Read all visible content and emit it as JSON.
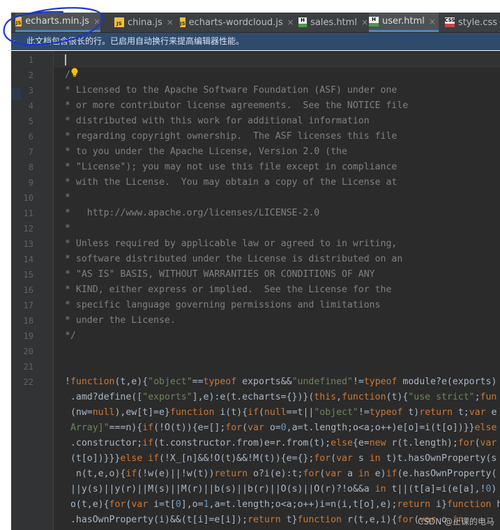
{
  "tabs": [
    {
      "label": "echarts.min.js",
      "type": "js",
      "icon": "JS",
      "active": true
    },
    {
      "label": "china.js",
      "type": "js",
      "icon": "JS",
      "active": false
    },
    {
      "label": "echarts-wordcloud.js",
      "type": "js",
      "icon": "JS",
      "active": false
    },
    {
      "label": "sales.html",
      "type": "html",
      "icon": "H",
      "active": false
    },
    {
      "label": "user.html",
      "type": "html",
      "icon": "H",
      "active": true
    },
    {
      "label": "style.css",
      "type": "css",
      "icon": "CSS",
      "active": false
    }
  ],
  "close_glyph": "×",
  "notice": {
    "chevron": "‹",
    "text": "此文档包含很长的行。已启用自动换行来提高编辑器性能。"
  },
  "line_numbers": [
    "1",
    "2",
    "3",
    "4",
    "5",
    "6",
    "7",
    "8",
    "9",
    "10",
    "11",
    "12",
    "13",
    "14",
    "15",
    "16",
    "17",
    "18",
    "19",
    "20",
    "21",
    "22"
  ],
  "comment_lines": [
    "",
    "/",
    "* Licensed to the Apache Software Foundation (ASF) under one",
    "* or more contributor license agreements.  See the NOTICE file",
    "* distributed with this work for additional information",
    "* regarding copyright ownership.  The ASF licenses this file",
    "* to you under the Apache License, Version 2.0 (the",
    "* \"License\"); you may not use this file except in compliance",
    "* with the License.  You may obtain a copy of the License at",
    "*",
    "*   http://www.apache.org/licenses/LICENSE-2.0",
    "*",
    "* Unless required by applicable law or agreed to in writing,",
    "* software distributed under the License is distributed on an",
    "* \"AS IS\" BASIS, WITHOUT WARRANTIES OR CONDITIONS OF ANY",
    "* KIND, either express or implied.  See the License for the",
    "* specific language governing permissions and limitations",
    "* under the License.",
    "*/",
    "",
    ""
  ],
  "code_lines": [
    [
      [
        "!",
        "p"
      ],
      [
        "function",
        "k"
      ],
      [
        "(t,e){",
        "p"
      ],
      [
        "\"object\"",
        "s"
      ],
      [
        "==",
        "p"
      ],
      [
        "typeof",
        "k"
      ],
      [
        " exports&&",
        "p"
      ],
      [
        "\"undefined\"",
        "s"
      ],
      [
        "!=",
        "p"
      ],
      [
        "typeof",
        "k"
      ],
      [
        " module?e(exports)",
        "p"
      ]
    ],
    [
      [
        " .amd?define([",
        "p"
      ],
      [
        "\"exports\"",
        "s"
      ],
      [
        "],e):e(t.echarts={})}(",
        "p"
      ],
      [
        "this",
        "k"
      ],
      [
        ",",
        "p"
      ],
      [
        "function",
        "k"
      ],
      [
        "(t){",
        "p"
      ],
      [
        "\"use strict\"",
        "s"
      ],
      [
        ";",
        "p"
      ],
      [
        "fun",
        "k"
      ]
    ],
    [
      [
        " (nw=",
        "p"
      ],
      [
        "null",
        "k"
      ],
      [
        "),ew[t]=e}",
        "p"
      ],
      [
        "function",
        "k"
      ],
      [
        " i(t){",
        "p"
      ],
      [
        "if",
        "k"
      ],
      [
        "(",
        "p"
      ],
      [
        "null",
        "k"
      ],
      [
        "==t||",
        "p"
      ],
      [
        "\"object\"",
        "s"
      ],
      [
        "!=",
        "p"
      ],
      [
        "typeof",
        "k"
      ],
      [
        " t)",
        "p"
      ],
      [
        "return",
        "k"
      ],
      [
        " t;",
        "p"
      ],
      [
        "var",
        "k"
      ],
      [
        " e",
        "p"
      ]
    ],
    [
      [
        " Array]\"",
        "s"
      ],
      [
        "===n){",
        "p"
      ],
      [
        "if",
        "k"
      ],
      [
        "(!O(t)){e=[];",
        "p"
      ],
      [
        "for",
        "k"
      ],
      [
        "(",
        "p"
      ],
      [
        "var",
        "k"
      ],
      [
        " o=",
        "p"
      ],
      [
        "0",
        "n"
      ],
      [
        ",a=t.length;o<a;o++)e[o]=i(t[o])}}",
        "p"
      ],
      [
        "else",
        "k"
      ]
    ],
    [
      [
        " .constructor;",
        "p"
      ],
      [
        "if",
        "k"
      ],
      [
        "(t.constructor.from)e=r.from(t);",
        "p"
      ],
      [
        "else",
        "k"
      ],
      [
        "{e=",
        "p"
      ],
      [
        "new",
        "k"
      ],
      [
        " r(t.length);",
        "p"
      ],
      [
        "for",
        "k"
      ],
      [
        "(",
        "p"
      ],
      [
        "var",
        "k"
      ]
    ],
    [
      [
        " (t[o])}}}",
        "p"
      ],
      [
        "else if",
        "k"
      ],
      [
        "(!X_[n]&&!O(t)&&!M(t)){e={};",
        "p"
      ],
      [
        "for",
        "k"
      ],
      [
        "(",
        "p"
      ],
      [
        "var",
        "k"
      ],
      [
        " s ",
        "p"
      ],
      [
        "in",
        "k"
      ],
      [
        " t)t.hasOwnProperty(s",
        "p"
      ]
    ],
    [
      [
        "  n(t,e,o){",
        "p"
      ],
      [
        "if",
        "k"
      ],
      [
        "(!w(e)||!w(t))",
        "p"
      ],
      [
        "return",
        "k"
      ],
      [
        " o?i(e):t;",
        "p"
      ],
      [
        "for",
        "k"
      ],
      [
        "(",
        "p"
      ],
      [
        "var",
        "k"
      ],
      [
        " a ",
        "p"
      ],
      [
        "in",
        "k"
      ],
      [
        " e)",
        "p"
      ],
      [
        "if",
        "k"
      ],
      [
        "(e.hasOwnProperty(",
        "p"
      ]
    ],
    [
      [
        " ||y(s)||y(r)||M(s)||M(r)||b(s)||b(r)||O(s)||O(r)?!o&&a ",
        "p"
      ],
      [
        "in",
        "k"
      ],
      [
        " t||(t[a]=i(e[a],!",
        "p"
      ],
      [
        "0",
        "n"
      ],
      [
        ")",
        "p"
      ]
    ],
    [
      [
        " o(t,e){",
        "p"
      ],
      [
        "for",
        "k"
      ],
      [
        "(",
        "p"
      ],
      [
        "var",
        "k"
      ],
      [
        " i=t[",
        "p"
      ],
      [
        "0",
        "n"
      ],
      [
        "],o=",
        "p"
      ],
      [
        "1",
        "n"
      ],
      [
        ",a=t.length;o<a;o++)i=n(i,t[o],e);",
        "p"
      ],
      [
        "return",
        "k"
      ],
      [
        " i}",
        "p"
      ],
      [
        "function",
        "k"
      ],
      [
        " h",
        "p"
      ]
    ],
    [
      [
        " .hasOwnProperty(i)&&(t[i]=e[i]);",
        "p"
      ],
      [
        "return",
        "k"
      ],
      [
        " t}",
        "p"
      ],
      [
        "function",
        "k"
      ],
      [
        " r(t,e,i){",
        "p"
      ],
      [
        "for",
        "k"
      ],
      [
        "(",
        "p"
      ],
      [
        "var",
        "k"
      ],
      [
        " o ",
        "p"
      ],
      [
        "in",
        "k"
      ]
    ]
  ],
  "watermark": "CSDN @止课的电马",
  "colors": {
    "editor_bg": "#2b2b2b",
    "gutter_bg": "#313335",
    "comment": "#808080",
    "keyword": "#cc7832",
    "string": "#6a8759",
    "number": "#6897bb",
    "plain": "#a9b7c6",
    "notice_bg": "#2e4b6e",
    "annotation": "#1a35d6"
  },
  "icons": [
    "js-file-icon",
    "html-file-icon",
    "css-file-icon",
    "close-icon",
    "lightbulb-icon",
    "chevron-left-icon"
  ]
}
